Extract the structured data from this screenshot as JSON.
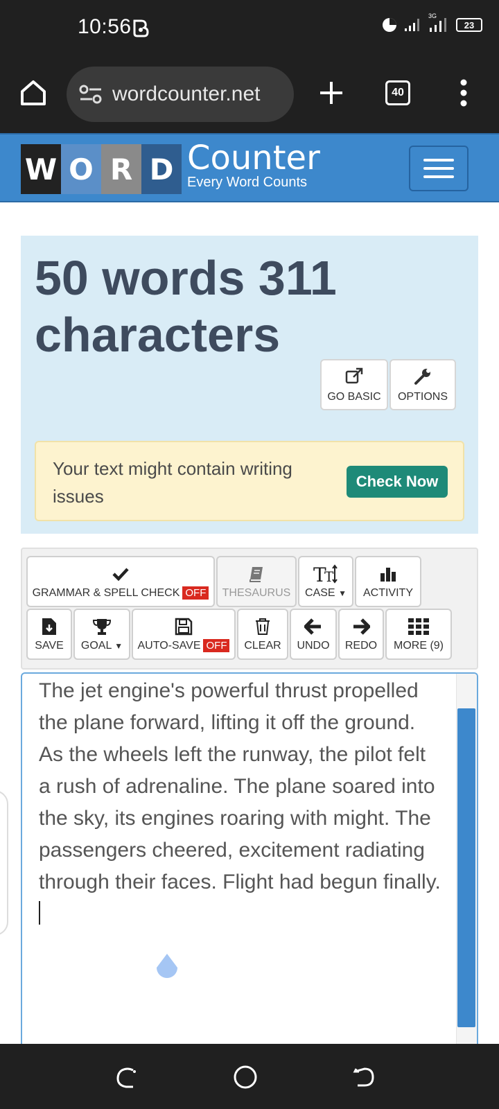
{
  "status_bar": {
    "time": "10:56",
    "network": "3G",
    "battery": "23"
  },
  "browser": {
    "url": "wordcounter.net",
    "tab_count": "40"
  },
  "site": {
    "logo_letters": [
      "W",
      "O",
      "R",
      "D"
    ],
    "logo_tile_colors": [
      "#222222",
      "#5b8fc8",
      "#8a8a8a",
      "#2f5d8f"
    ],
    "logo_title": "Counter",
    "logo_tagline": "Every Word Counts",
    "accent_color": "#3d88cc"
  },
  "count": {
    "headline": "50 words 311 characters"
  },
  "top_tools": {
    "go_basic": "GO BASIC",
    "options": "OPTIONS"
  },
  "alert": {
    "message": "Your text might contain writing issues",
    "button": "Check Now"
  },
  "toolbar": {
    "grammar_label": "GRAMMAR & SPELL CHECK",
    "grammar_state": "OFF",
    "thesaurus": "THESAURUS",
    "case": "CASE",
    "activity": "ACTIVITY",
    "save": "SAVE",
    "goal": "GOAL",
    "autosave_label": "AUTO-SAVE",
    "autosave_state": "OFF",
    "clear": "CLEAR",
    "undo": "UNDO",
    "redo": "REDO",
    "more": "MORE (9)"
  },
  "editor": {
    "text": "The jet engine's powerful thrust propelled the plane forward, lifting it off the ground. As the wheels left the runway, the pilot felt a rush of adrenaline. The plane soared into the sky, its engines roaring with might. The passengers cheered, excitement radiating through their faces. Flight had begun finally."
  }
}
